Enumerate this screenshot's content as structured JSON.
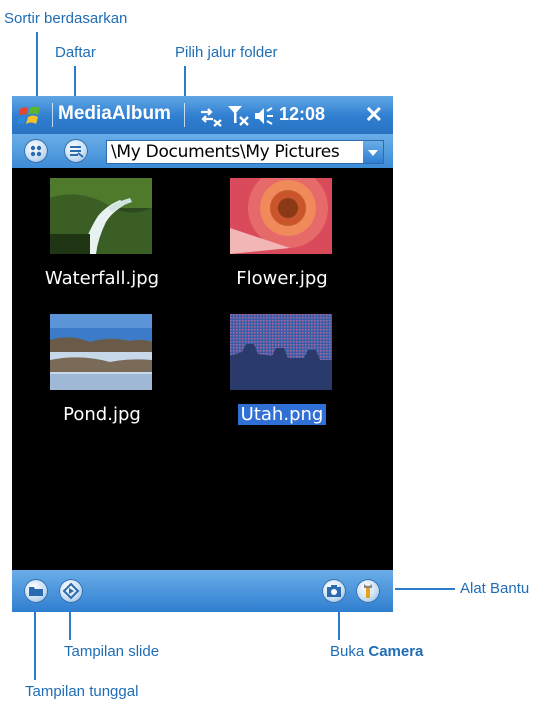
{
  "callouts": {
    "sort": "Sortir berdasarkan",
    "list": "Daftar",
    "folder_path": "Pilih jalur folder",
    "tools": "Alat Bantu",
    "slideshow": "Tampilan slide",
    "camera_prefix": "Buka ",
    "camera_bold": "Camera",
    "single_view": "Tampilan tunggal"
  },
  "titlebar": {
    "app_title": "MediaAlbum",
    "time": "12:08",
    "close": "✕"
  },
  "toolbar": {
    "folder_path": "\\My Documents\\My Pictures"
  },
  "files": [
    {
      "name": "Waterfall.jpg",
      "selected": false
    },
    {
      "name": "Flower.jpg",
      "selected": false
    },
    {
      "name": "Pond.jpg",
      "selected": false
    },
    {
      "name": "Utah.png",
      "selected": true
    }
  ],
  "colors": {
    "accent": "#2f7ed0",
    "callout_text": "#1f6db5",
    "selection": "#2f6fd6"
  }
}
